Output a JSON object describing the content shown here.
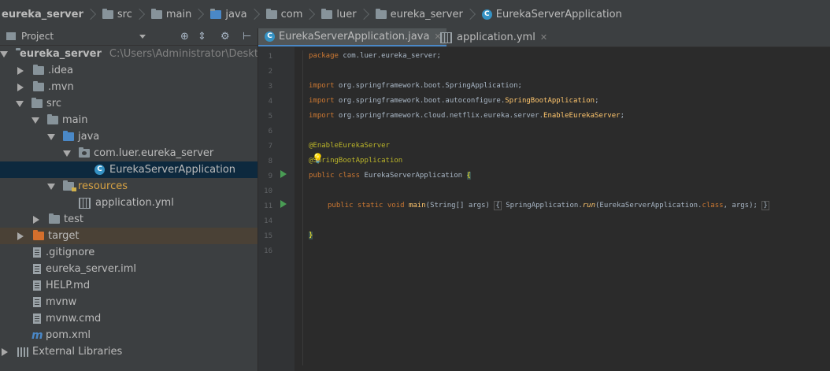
{
  "breadcrumb": [
    "eureka_server",
    "src",
    "main",
    "java",
    "com",
    "luer",
    "eureka_server",
    "EurekaServerApplication"
  ],
  "project_panel": {
    "title": "Project",
    "tree": [
      {
        "label": "eureka_server",
        "path": "C:\\Users\\Administrator\\Desktop\\s"
      },
      {
        "label": ".idea"
      },
      {
        "label": ".mvn"
      },
      {
        "label": "src"
      },
      {
        "label": "main"
      },
      {
        "label": "java"
      },
      {
        "label": "com.luer.eureka_server"
      },
      {
        "label": "EurekaServerApplication"
      },
      {
        "label": "resources"
      },
      {
        "label": "application.yml"
      },
      {
        "label": "test"
      },
      {
        "label": "target"
      },
      {
        "label": ".gitignore"
      },
      {
        "label": "eureka_server.iml"
      },
      {
        "label": "HELP.md"
      },
      {
        "label": "mvnw"
      },
      {
        "label": "mvnw.cmd"
      },
      {
        "label": "pom.xml"
      },
      {
        "label": "External Libraries"
      }
    ]
  },
  "tabs": [
    {
      "label": "EurekaServerApplication.java",
      "active": true
    },
    {
      "label": "application.yml",
      "active": false
    }
  ],
  "editor": {
    "line_numbers": [
      "1",
      "2",
      "3",
      "4",
      "5",
      "6",
      "7",
      "8",
      "9",
      "10",
      "11",
      "14",
      "15",
      "16"
    ],
    "code": {
      "l1_kw": "package",
      "l1_rest": " com.luer.eureka_server;",
      "l3_kw": "import",
      "l3_a": " org.springframework.boot.",
      "l3_b": "SpringApplication;",
      "l4_kw": "import",
      "l4_a": " org.springframework.boot.autoconfigure.",
      "l4_b": "SpringBootApplication",
      "l4_c": ";",
      "l5_kw": "import",
      "l5_a": " org.springframework.cloud.netflix.eureka.server.",
      "l5_b": "EnableEurekaServer",
      "l5_c": ";",
      "l7_ann": "@EnableEurekaServer",
      "l8_ann": "@SpringBootApplication",
      "l9_kw": "public class",
      "l9_name": " EurekaServerApplication ",
      "l9_brace": "{",
      "l11_kw": "public static void",
      "l11_fn": "main",
      "l11_args": "(String[] args)",
      "l11_open": "{",
      "l11_body_a": " SpringApplication.",
      "l11_body_run": "run",
      "l11_body_b": "(EurekaServerApplication.",
      "l11_body_kw": "class",
      "l11_body_c": ", args);",
      "l11_close": "}",
      "l15_brace": "}"
    }
  },
  "colors": {
    "keyword": "#cc7832",
    "annotation": "#bbb529",
    "method": "#ffc66d",
    "text": "#a9b7c6",
    "selection": "#0d293e"
  }
}
